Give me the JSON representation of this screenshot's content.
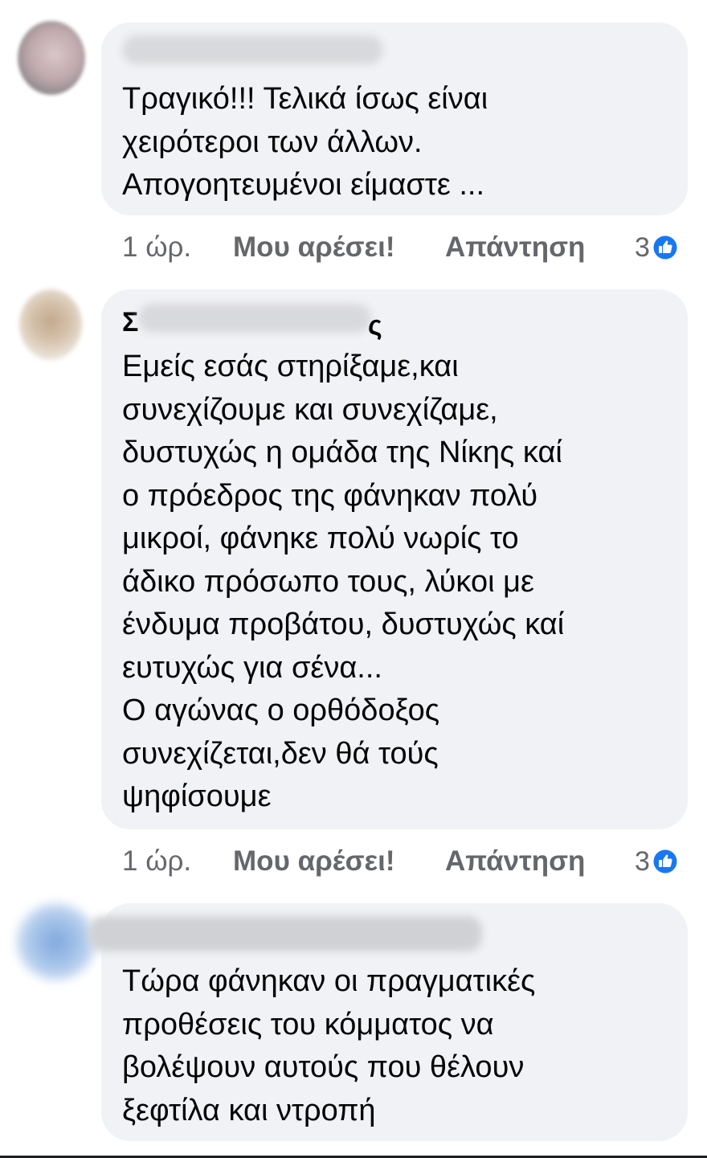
{
  "colors": {
    "bubble": "#f0f2f5",
    "meta_text": "#65676b",
    "like_blue": "#1877f2",
    "body_text": "#050505"
  },
  "comments": [
    {
      "name_prefix": "",
      "name_suffix": "",
      "text": "Τραγικό!!! Τελικά ίσως είναι\nχειρότεροι των άλλων.\nΑπογοητευμένοι είμαστε ...",
      "time": "1 ώρ.",
      "like_label": "Μου αρέσει!",
      "reply_label": "Απάντηση",
      "reaction_count": "3",
      "reaction_icon": "like-icon"
    },
    {
      "name_prefix": "Σ",
      "name_suffix": "ς",
      "text": "Εμείς εσάς στηρίξαμε,και\nσυνεχίζουμε και συνεχίζαμε,\nδυστυχώς η ομάδα της Νίκης καί\nο πρόεδρος της φάνηκαν πολύ\nμικροί, φάνηκε πολύ νωρίς το\nάδικο πρόσωπο τους, λύκοι με\nένδυμα προβάτου, δυστυχώς καί\nευτυχώς για σένα...\nΟ αγώνας ο ορθόδοξος\nσυνεχίζεται,δεν θά τούς\nψηφίσουμε",
      "time": "1 ώρ.",
      "like_label": "Μου αρέσει!",
      "reply_label": "Απάντηση",
      "reaction_count": "3",
      "reaction_icon": "like-icon"
    },
    {
      "name_prefix": "",
      "name_suffix": "",
      "text": "Τώρα φάνηκαν οι πραγματικές\nπροθέσεις του κόμματος να\nβολέψουν αυτούς που θέλουν\nξεφτίλα και ντροπή"
    }
  ]
}
